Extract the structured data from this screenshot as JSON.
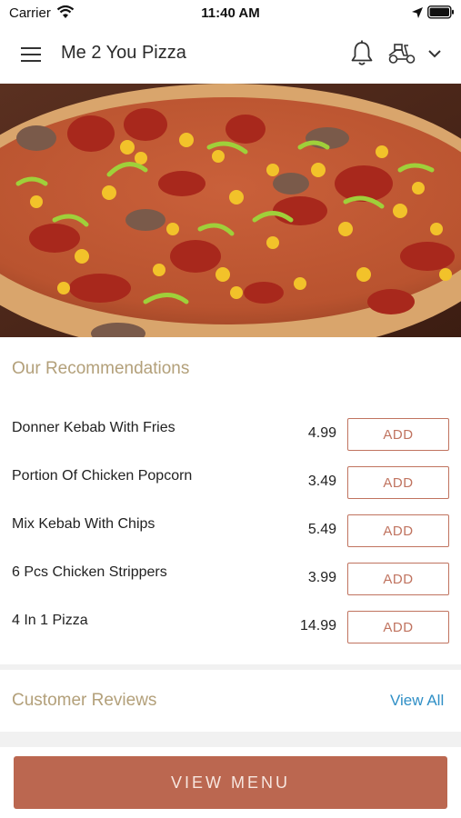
{
  "status_bar": {
    "carrier": "Carrier",
    "time": "11:40 AM"
  },
  "header": {
    "title": "Me 2 You Pizza"
  },
  "recommendations": {
    "title": "Our Recommendations",
    "items": [
      {
        "name": "Donner Kebab With Fries",
        "price": "4.99",
        "button": "ADD"
      },
      {
        "name": "Portion Of Chicken Popcorn",
        "price": "3.49",
        "button": "ADD"
      },
      {
        "name": "Mix Kebab With Chips",
        "price": "5.49",
        "button": "ADD"
      },
      {
        "name": "6 Pcs Chicken Strippers",
        "price": "3.99",
        "button": "ADD"
      },
      {
        "name": "4 In 1 Pizza",
        "price": "14.99",
        "button": "ADD"
      }
    ]
  },
  "reviews": {
    "title": "Customer Reviews",
    "view_all": "View All"
  },
  "footer": {
    "view_menu": "VIEW MENU"
  },
  "colors": {
    "accent": "#bb6750",
    "section_title": "#b3a07a",
    "link": "#2f8fc6"
  },
  "icons": [
    "wifi-icon",
    "location-icon",
    "battery-icon",
    "menu-icon",
    "bell-icon",
    "scooter-icon",
    "chevron-down-icon"
  ]
}
